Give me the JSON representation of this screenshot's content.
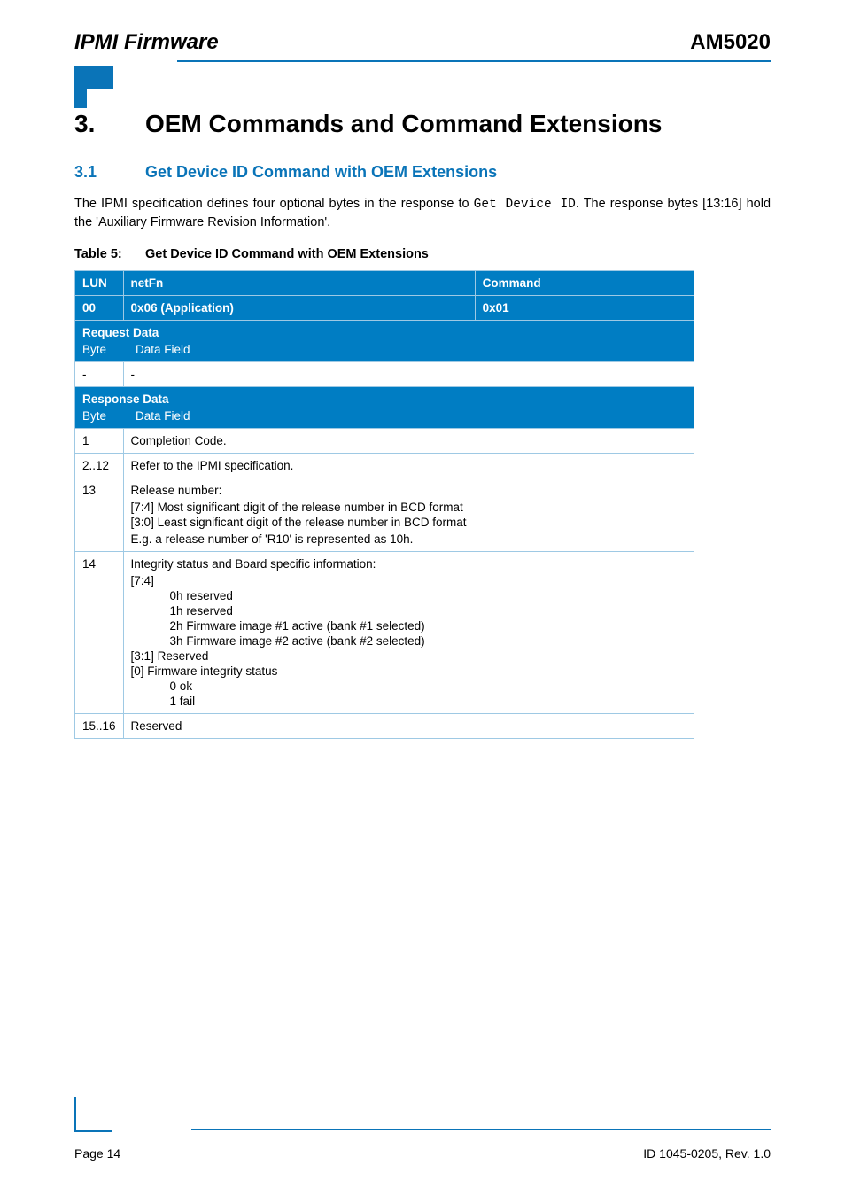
{
  "header": {
    "left": "IPMI Firmware",
    "right": "AM5020"
  },
  "h1": {
    "num": "3.",
    "text": "OEM Commands and Command Extensions"
  },
  "h2": {
    "num": "3.1",
    "text": "Get Device ID Command with OEM Extensions"
  },
  "para": {
    "pre": "The IPMI specification defines four optional bytes in the response to ",
    "mono": "Get Device ID",
    "post": ". The response bytes [13:16] hold the 'Auxiliary Firmware Revision Information'."
  },
  "caption": {
    "label": "Table 5:",
    "text": "Get Device ID Command with OEM Extensions"
  },
  "thead": {
    "lun_label": "LUN",
    "lun_val": "00",
    "netfn_label": "netFn",
    "netfn_val": "0x06 (Application)",
    "cmd_label": "Command",
    "cmd_val": "0x01"
  },
  "sections": {
    "request": "Request Data",
    "response": "Response Data"
  },
  "rows": {
    "req0": {
      "byte": "-",
      "df": "-"
    },
    "r1": {
      "byte": "1",
      "df": "Completion Code."
    },
    "r2_12": {
      "byte": "2..12",
      "df": "Refer to the IPMI specification."
    },
    "r13": {
      "byte": "13",
      "title": "Release number:",
      "l1": "[7:4]  Most significant digit of the release number in BCD format",
      "l2": "[3:0]  Least significant digit of the release number in BCD format",
      "note": "E.g. a release number of 'R10' is represented as 10h."
    },
    "r14": {
      "byte": "14",
      "title": "Integrity status and Board specific information:",
      "l74": "[7:4]",
      "l74_1": "0h  reserved",
      "l74_2": "1h  reserved",
      "l74_3": "2h  Firmware image #1 active (bank #1 selected)",
      "l74_4": "3h  Firmware image #2 active (bank #2 selected)",
      "l31": "[3:1]  Reserved",
      "l0": "[0]    Firmware integrity status",
      "l0_1": "0  ok",
      "l0_2": "1  fail"
    },
    "r15_16": {
      "byte": "15..16",
      "df": "Reserved"
    }
  },
  "footer": {
    "left": "Page 14",
    "right": "ID 1045-0205, Rev. 1.0"
  }
}
